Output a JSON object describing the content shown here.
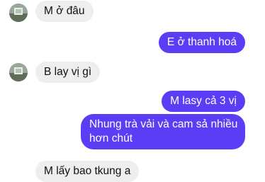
{
  "conversation": {
    "messages": [
      {
        "sender": "them",
        "text": "M ở đâu"
      },
      {
        "sender": "me",
        "text": "E ở thanh hoá"
      },
      {
        "sender": "them",
        "text": "B lay vị gì"
      },
      {
        "sender": "me",
        "text": "M lasy cả 3 vị"
      },
      {
        "sender": "me",
        "text_lines": [
          "Nhung trà vải và cam sả nhiều",
          "hơn chút"
        ]
      },
      {
        "sender": "them",
        "text": "M lấy bao tkung a"
      }
    ]
  },
  "colors": {
    "outgoing_bubble": "#5b3df5",
    "incoming_bubble": "#eeeeef",
    "background": "#ffffff"
  }
}
